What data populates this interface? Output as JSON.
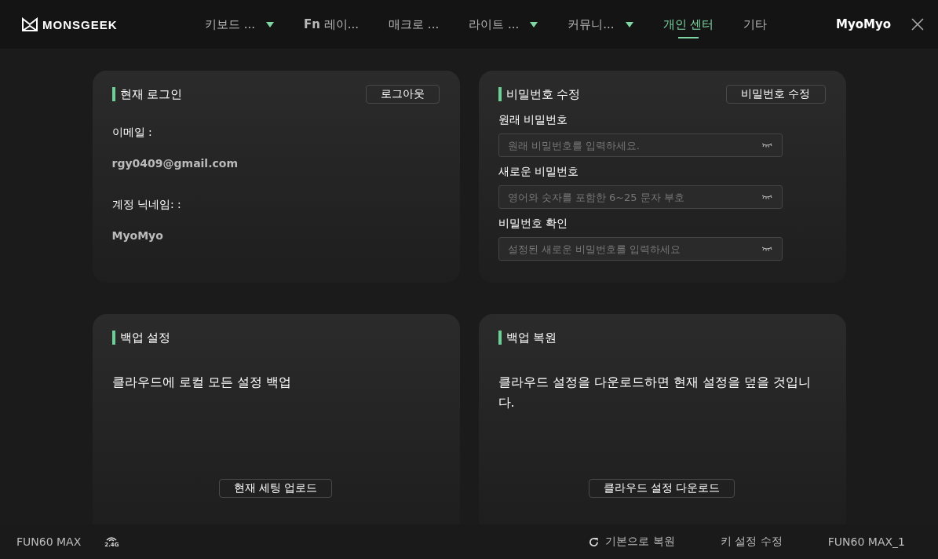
{
  "header": {
    "logo": "MONSGEEK",
    "nav": [
      {
        "label": "키보드 ...",
        "kind": "dropdown",
        "selected": false
      },
      {
        "label": "**Fn** 레이...",
        "kind": "plain",
        "selected": false
      },
      {
        "label": "매크로 ...",
        "kind": "plain",
        "selected": false
      },
      {
        "label": "라이트 ...",
        "kind": "dropdown",
        "selected": false
      },
      {
        "label": "커뮤니...",
        "kind": "dropdown",
        "selected": false
      },
      {
        "label": "개인 센터",
        "kind": "plain",
        "selected": true
      },
      {
        "label": "기타",
        "kind": "plain",
        "selected": false
      }
    ],
    "user": "MyoMyo"
  },
  "login_card": {
    "title": "현재 로그인",
    "button": "로그아웃",
    "fields": [
      {
        "label": "이메일 :",
        "value": "rgy0409@gmail.com"
      },
      {
        "label": "계정 닉네임: :",
        "value": "MyoMyo"
      }
    ]
  },
  "password_card": {
    "title": "비밀번호 수정",
    "button": "비밀번호 수정",
    "fields": [
      {
        "label": "원래 비밀번호",
        "placeholder": "원래 비밀번호를 입력하세요."
      },
      {
        "label": "새로운 비밀번호",
        "placeholder": "영어와 숫자를 포함한 6~25 문자 부호"
      },
      {
        "label": "비밀번호 확인",
        "placeholder": "설정된 새로운 비밀번호를 입력하세요"
      }
    ]
  },
  "backup_card": {
    "title": "백업 설정",
    "text": "클라우드에 로컬 모든 설정 백업",
    "button": "현재 세팅 업로드"
  },
  "restore_card": {
    "title": "백업 복원",
    "text": "클라우드 설정을 다운로드하면 현재 설정을 덮을 것입니다.",
    "button": "클라우드 설정 다운로드"
  },
  "status_bar": {
    "device": "FUN60 MAX",
    "wireless": "2.4G",
    "reset": "기본으로 복원",
    "key_settings": "키 설정 수정",
    "profile": "FUN60 MAX_1"
  }
}
